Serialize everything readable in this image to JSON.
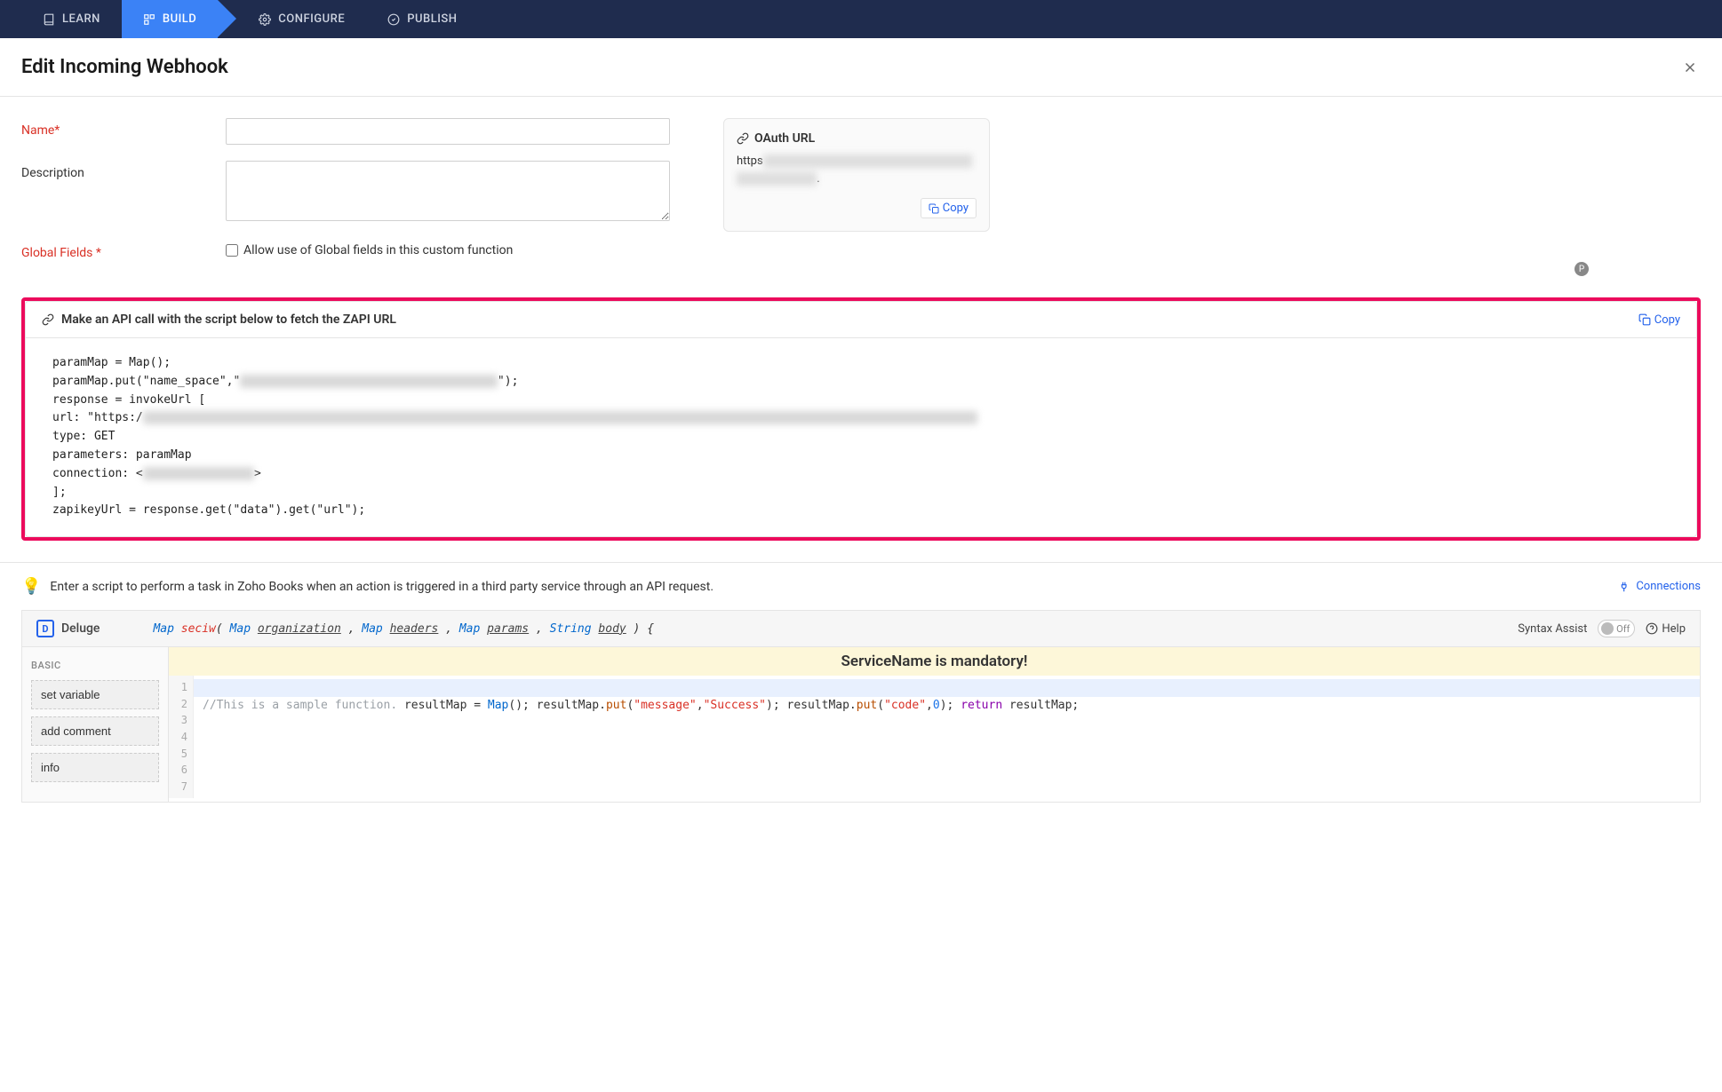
{
  "nav": {
    "items": [
      {
        "label": "LEARN",
        "icon": "book"
      },
      {
        "label": "BUILD",
        "icon": "blocks",
        "active": true
      },
      {
        "label": "CONFIGURE",
        "icon": "gear"
      },
      {
        "label": "PUBLISH",
        "icon": "check-circle"
      }
    ]
  },
  "header": {
    "title": "Edit Incoming Webhook"
  },
  "form": {
    "name_label": "Name*",
    "name_value": "",
    "description_label": "Description",
    "description_value": "",
    "global_fields_label": "Global Fields *",
    "global_fields_checkbox_label": "Allow use of Global fields in this custom function"
  },
  "oauth": {
    "title": "OAuth URL",
    "url_prefix": "https",
    "url_redacted": "[redacted]",
    "url_suffix": ".",
    "copy_label": "Copy"
  },
  "api_box": {
    "title": "Make an API call with the script below to fetch the ZAPI URL",
    "copy_label": "Copy",
    "lines": [
      "paramMap = Map();",
      "paramMap.put(\"name_space\",\"[redacted]\");",
      "response = invokeUrl [",
      "url: \"https://[redacted]\"",
      "type: GET",
      "parameters: paramMap",
      "connection: <[redacted]>",
      "];",
      "zapikeyUrl = response.get(\"data\").get(\"url\");"
    ]
  },
  "hint": {
    "text": "Enter a script to perform a task in Zoho Books when an action is triggered in a third party service through an API request.",
    "connections_label": "Connections"
  },
  "editor": {
    "language": "Deluge",
    "signature": {
      "return_type": "Map",
      "fn_name": "seciw",
      "params": [
        {
          "type": "Map",
          "name": "organization"
        },
        {
          "type": "Map",
          "name": "headers"
        },
        {
          "type": "Map",
          "name": "params"
        },
        {
          "type": "String",
          "name": "body"
        }
      ]
    },
    "syntax_assist_label": "Syntax Assist",
    "syntax_assist_toggle": "Off",
    "help_label": "Help",
    "sidebar_heading": "BASIC",
    "sidebar_items": [
      "set variable",
      "add comment",
      "info"
    ],
    "warning": "ServiceName is mandatory!",
    "code_lines": [
      "",
      "//This is a sample function.",
      "resultMap = Map();",
      "resultMap.put(\"message\",\"Success\");",
      "resultMap.put(\"code\",0);",
      "return resultMap;",
      ""
    ]
  },
  "badge": {
    "letter": "P"
  }
}
